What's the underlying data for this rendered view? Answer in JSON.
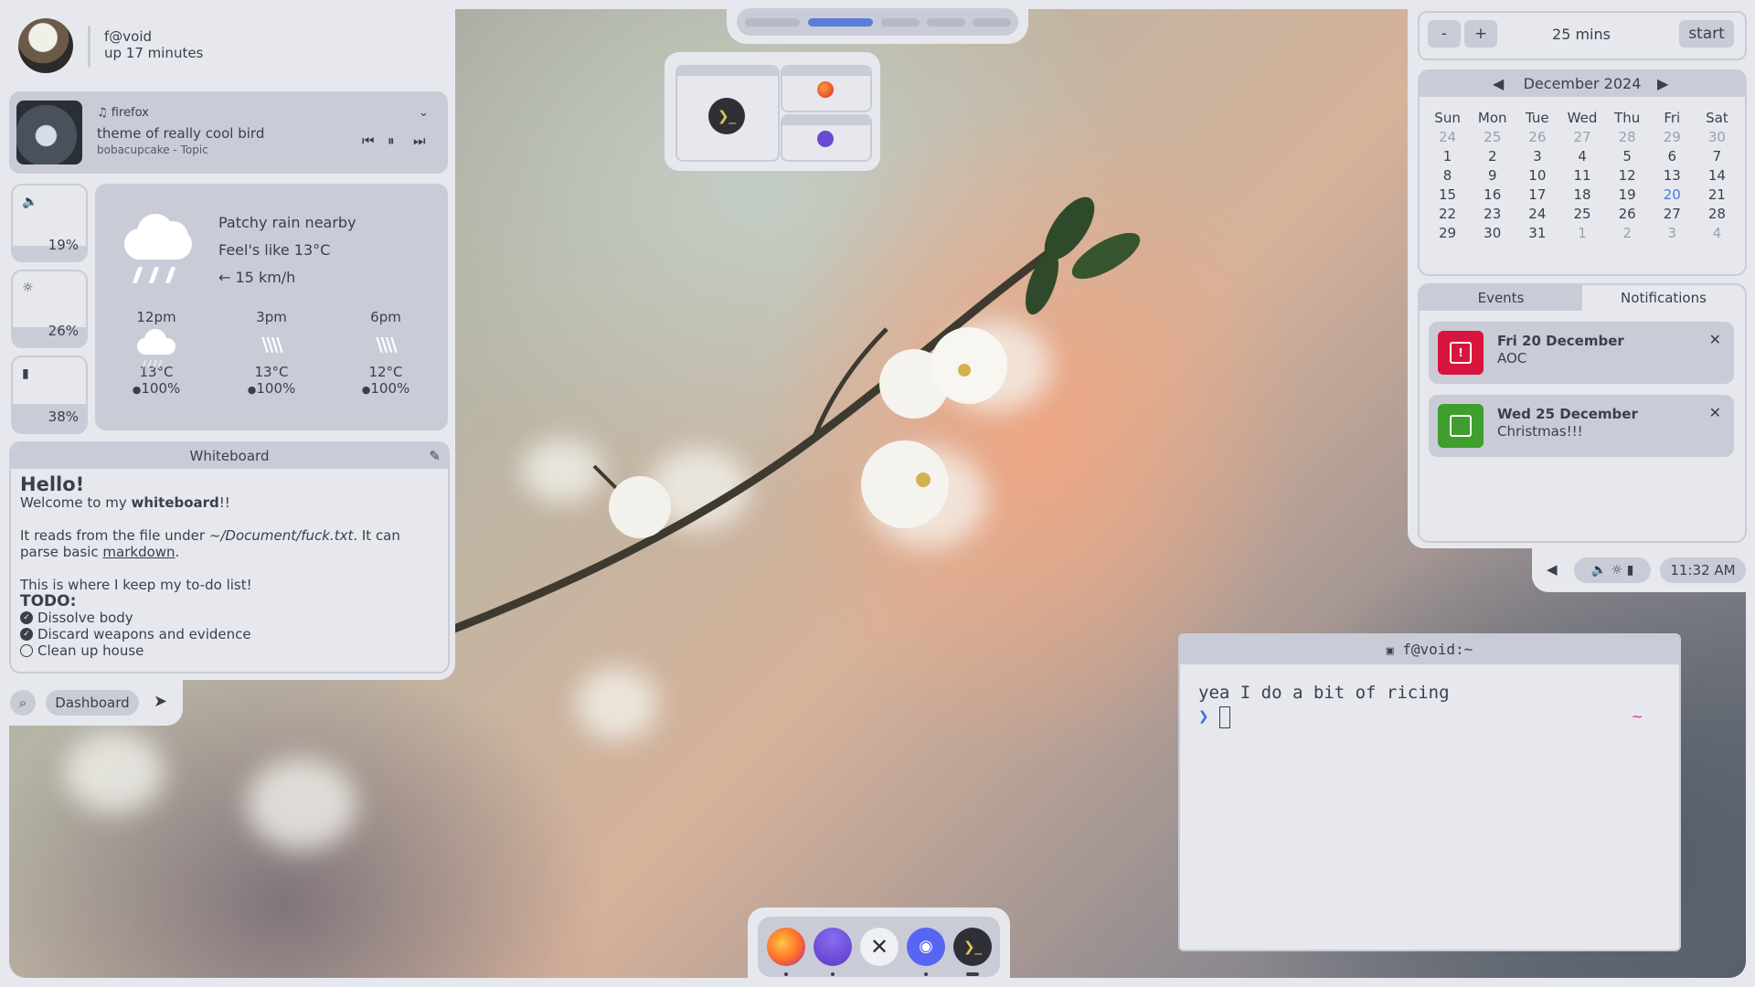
{
  "profile": {
    "username": "f@void",
    "uptime": "up 17 minutes"
  },
  "media": {
    "source": "firefox",
    "title": "theme of really cool bird",
    "artist": "bobacupcake - Topic",
    "icons": [
      "music-note-icon",
      "chevron-down-icon",
      "previous-icon",
      "pause-icon",
      "next-icon"
    ]
  },
  "sliders": [
    {
      "name": "volume",
      "icon": "🔈",
      "value": "19%",
      "level": 0.19
    },
    {
      "name": "brightness",
      "icon": "☼",
      "value": "26%",
      "level": 0.26
    },
    {
      "name": "battery",
      "icon": "▮",
      "value": "38%",
      "level": 0.38
    }
  ],
  "weather": {
    "condition": "Patchy rain nearby",
    "feels_like": "Feel's like 13°C",
    "wind": "← 15 km/h",
    "forecast": [
      {
        "time": "12pm",
        "temp": "13°C",
        "rain": "100%"
      },
      {
        "time": "3pm",
        "temp": "13°C",
        "rain": "100%"
      },
      {
        "time": "6pm",
        "temp": "12°C",
        "rain": "100%"
      }
    ]
  },
  "whiteboard": {
    "title": "Whiteboard",
    "heading": "Hello!",
    "line1_pre": "Welcome to my ",
    "line1_bold": "whiteboard",
    "line1_post": "!!",
    "line2_pre": "It reads from the file under ",
    "line2_path": "~/Document/fuck.txt",
    "line2_post": ". It can",
    "line3_pre": "parse basic ",
    "line3_link": "markdown",
    "line3_post": ".",
    "line4": "This is where I keep my to-do list!",
    "todo_heading": "TODO:",
    "todos": [
      {
        "text": "Dissolve body",
        "done": true
      },
      {
        "text": "Discard weapons and evidence",
        "done": true
      },
      {
        "text": "Clean up house",
        "done": false
      }
    ]
  },
  "bottombar": {
    "dashboard_label": "Dashboard"
  },
  "timer": {
    "minus": "-",
    "plus": "+",
    "duration": "25 mins",
    "start": "start"
  },
  "calendar": {
    "month": "December 2024",
    "weekdays": [
      "Sun",
      "Mon",
      "Tue",
      "Wed",
      "Thu",
      "Fri",
      "Sat"
    ],
    "days": [
      "24",
      "25",
      "26",
      "27",
      "28",
      "29",
      "30",
      "1",
      "2",
      "3",
      "4",
      "5",
      "6",
      "7",
      "8",
      "9",
      "10",
      "11",
      "12",
      "13",
      "14",
      "15",
      "16",
      "17",
      "18",
      "19",
      "20",
      "21",
      "22",
      "23",
      "24",
      "25",
      "26",
      "27",
      "28",
      "29",
      "30",
      "31",
      "1",
      "2",
      "3",
      "4"
    ],
    "today": "20"
  },
  "events_panel": {
    "tabs": [
      "Events",
      "Notifications"
    ],
    "events": [
      {
        "date": "Fri 20 December",
        "title": "AOC",
        "color": "#d8153c"
      },
      {
        "date": "Wed 25 December",
        "title": "Christmas!!!",
        "color": "#3e9e2e"
      }
    ]
  },
  "systray": {
    "clock": "11:32 AM"
  },
  "terminal": {
    "title": "f@void:~",
    "line1": "yea I do a bit of ricing",
    "prompt": "❯",
    "tilde": "~"
  },
  "dock": {
    "apps": [
      "firefox-icon",
      "purple-app-icon",
      "x-app-icon",
      "discord-icon",
      "terminal-icon"
    ]
  },
  "colors": {
    "accent": "#5a7dd8",
    "panel": "#e6e8ee",
    "card": "#c9ccd6",
    "text": "#3a3f4b"
  }
}
